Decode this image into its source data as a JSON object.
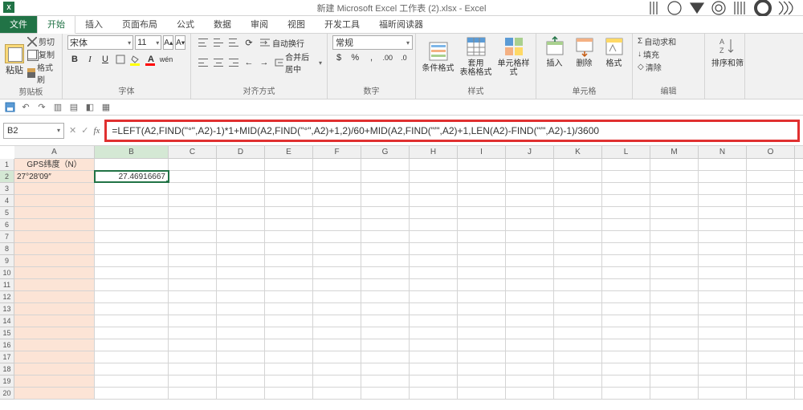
{
  "title": "新建 Microsoft Excel 工作表 (2).xlsx - Excel",
  "tabs": {
    "file": "文件",
    "home": "开始",
    "insert": "插入",
    "layout": "页面布局",
    "formulas": "公式",
    "data": "数据",
    "review": "审阅",
    "view": "视图",
    "dev": "开发工具",
    "foxit": "福昕阅读器"
  },
  "clipboard": {
    "paste": "粘贴",
    "cut": "剪切",
    "copy": "复制",
    "brush": "格式刷",
    "label": "剪贴板"
  },
  "font": {
    "name": "宋体",
    "size": "11",
    "label": "字体"
  },
  "align": {
    "wrap": "自动换行",
    "merge": "合并后居中",
    "label": "对齐方式"
  },
  "number": {
    "format": "常规",
    "label": "数字"
  },
  "styles": {
    "cond": "条件格式",
    "table": "套用\n表格格式",
    "cell": "单元格样式",
    "label": "样式"
  },
  "cells": {
    "insert": "插入",
    "delete": "删除",
    "format": "格式",
    "label": "单元格"
  },
  "editing": {
    "sum": "自动求和",
    "fill": "填充",
    "clear": "清除",
    "sort": "排序和筛",
    "label": "编辑"
  },
  "namebox": "B2",
  "formula": "=LEFT(A2,FIND(\"°\",A2)-1)*1+MID(A2,FIND(\"°\",A2)+1,2)/60+MID(A2,FIND(\"′\",A2)+1,LEN(A2)-FIND(\"′\",A2)-1)/3600",
  "cols": [
    "A",
    "B",
    "C",
    "D",
    "E",
    "F",
    "G",
    "H",
    "I",
    "J",
    "K",
    "L",
    "M",
    "N",
    "O"
  ],
  "data_cells": {
    "A1": "GPS纬度（N）",
    "A2": "27°28′09″",
    "B2": "27.46916667"
  }
}
